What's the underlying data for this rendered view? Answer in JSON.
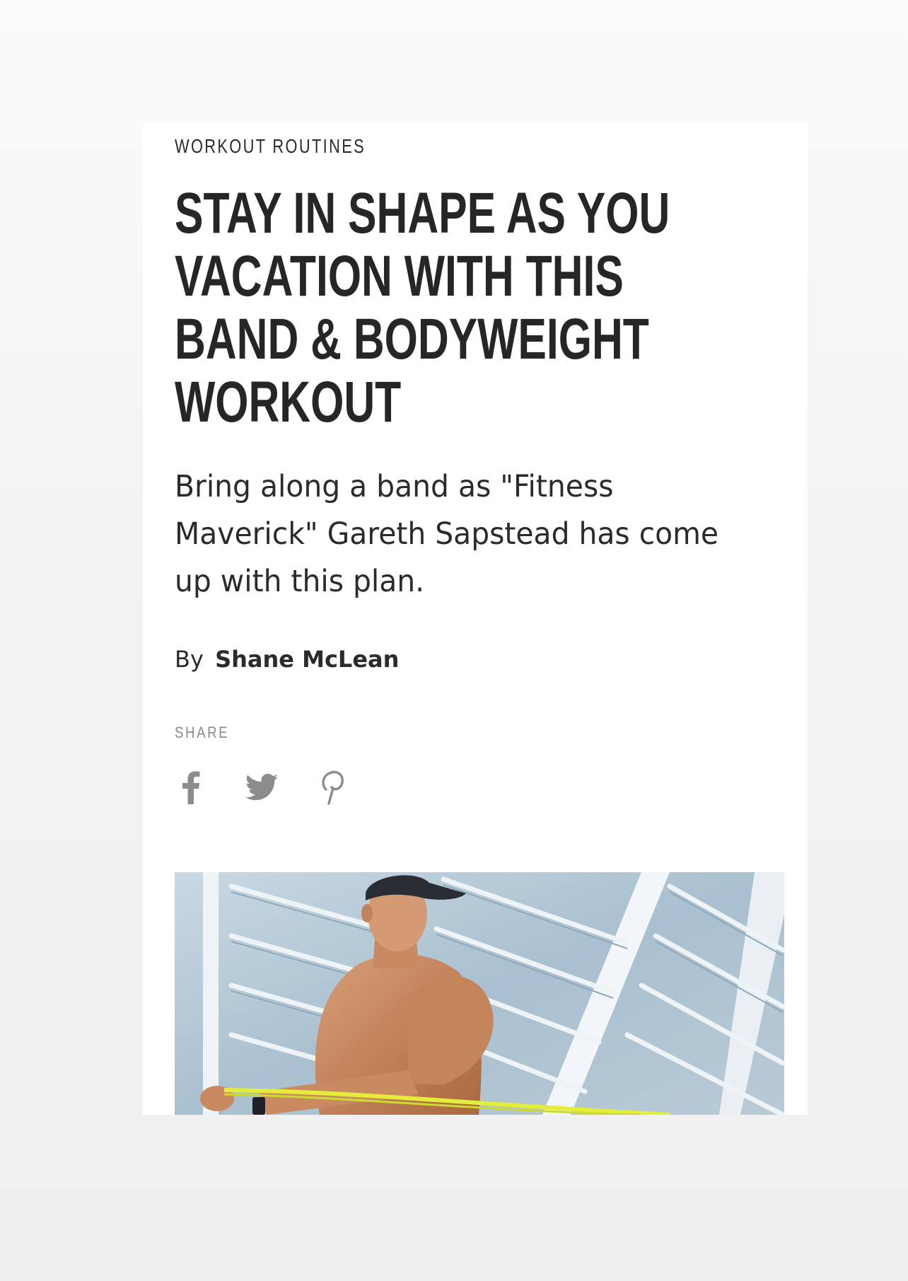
{
  "article": {
    "category": "WORKOUT ROUTINES",
    "title": "STAY IN SHAPE AS YOU VACATION WITH THIS BAND & BODYWEIGHT WORKOUT",
    "dek": "Bring along a band as \"Fitness Maverick\" Gareth Sapstead has come up with this plan.",
    "byline_prefix": "By",
    "author": "Shane McLean"
  },
  "share": {
    "label": "SHARE",
    "buttons": [
      {
        "icon": "facebook-icon"
      },
      {
        "icon": "twitter-icon"
      },
      {
        "icon": "pinterest-icon"
      }
    ]
  },
  "hero": {
    "alt": "Shirtless man in a cap pulling a yellow resistance band in front of a glass building"
  },
  "colors": {
    "text": "#262626",
    "muted": "#8a8a8a",
    "icon": "#8c8c8c",
    "band": "#e4ee3a"
  }
}
